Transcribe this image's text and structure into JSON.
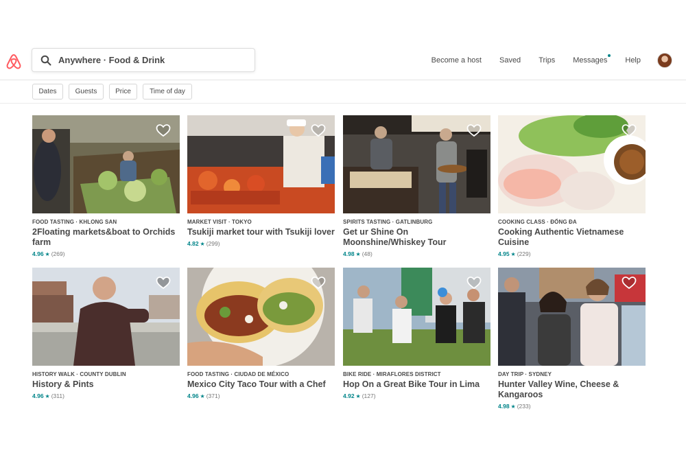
{
  "header": {
    "search_value": "Anywhere · Food & Drink",
    "nav": [
      "Become a host",
      "Saved",
      "Trips",
      "Messages",
      "Help"
    ]
  },
  "filters": [
    "Dates",
    "Guests",
    "Price",
    "Time of day"
  ],
  "colors": {
    "brand": "#ff5a5f",
    "accent": "#008489",
    "text": "#484848"
  },
  "listings": [
    {
      "meta": "FOOD TASTING · KHLONG SAN",
      "title": "2Floating markets&boat to Orchids farm",
      "score": "4.96",
      "count": "(269)"
    },
    {
      "meta": "MARKET VISIT · TOKYO",
      "title": "Tsukiji market tour with Tsukiji lover",
      "score": "4.82",
      "count": "(299)"
    },
    {
      "meta": "SPIRITS TASTING · GATLINBURG",
      "title": "Get ur Shine On Moonshine/Whiskey Tour",
      "score": "4.98",
      "count": "(48)"
    },
    {
      "meta": "COOKING CLASS · ĐỐNG ĐA",
      "title": "Cooking Authentic Vietnamese Cuisine",
      "score": "4.95",
      "count": "(229)"
    },
    {
      "meta": "HISTORY WALK · COUNTY DUBLIN",
      "title": "History & Pints",
      "score": "4.96",
      "count": "(311)"
    },
    {
      "meta": "FOOD TASTING · CIUDAD DE MÉXICO",
      "title": "Mexico City Taco Tour with a Chef",
      "score": "4.96",
      "count": "(371)"
    },
    {
      "meta": "BIKE RIDE · MIRAFLORES DISTRICT",
      "title": "Hop On a Great Bike Tour in Lima",
      "score": "4.92",
      "count": "(127)"
    },
    {
      "meta": "DAY TRIP · SYDNEY",
      "title": "Hunter Valley Wine, Cheese & Kangaroos",
      "score": "4.98",
      "count": "(233)"
    }
  ]
}
